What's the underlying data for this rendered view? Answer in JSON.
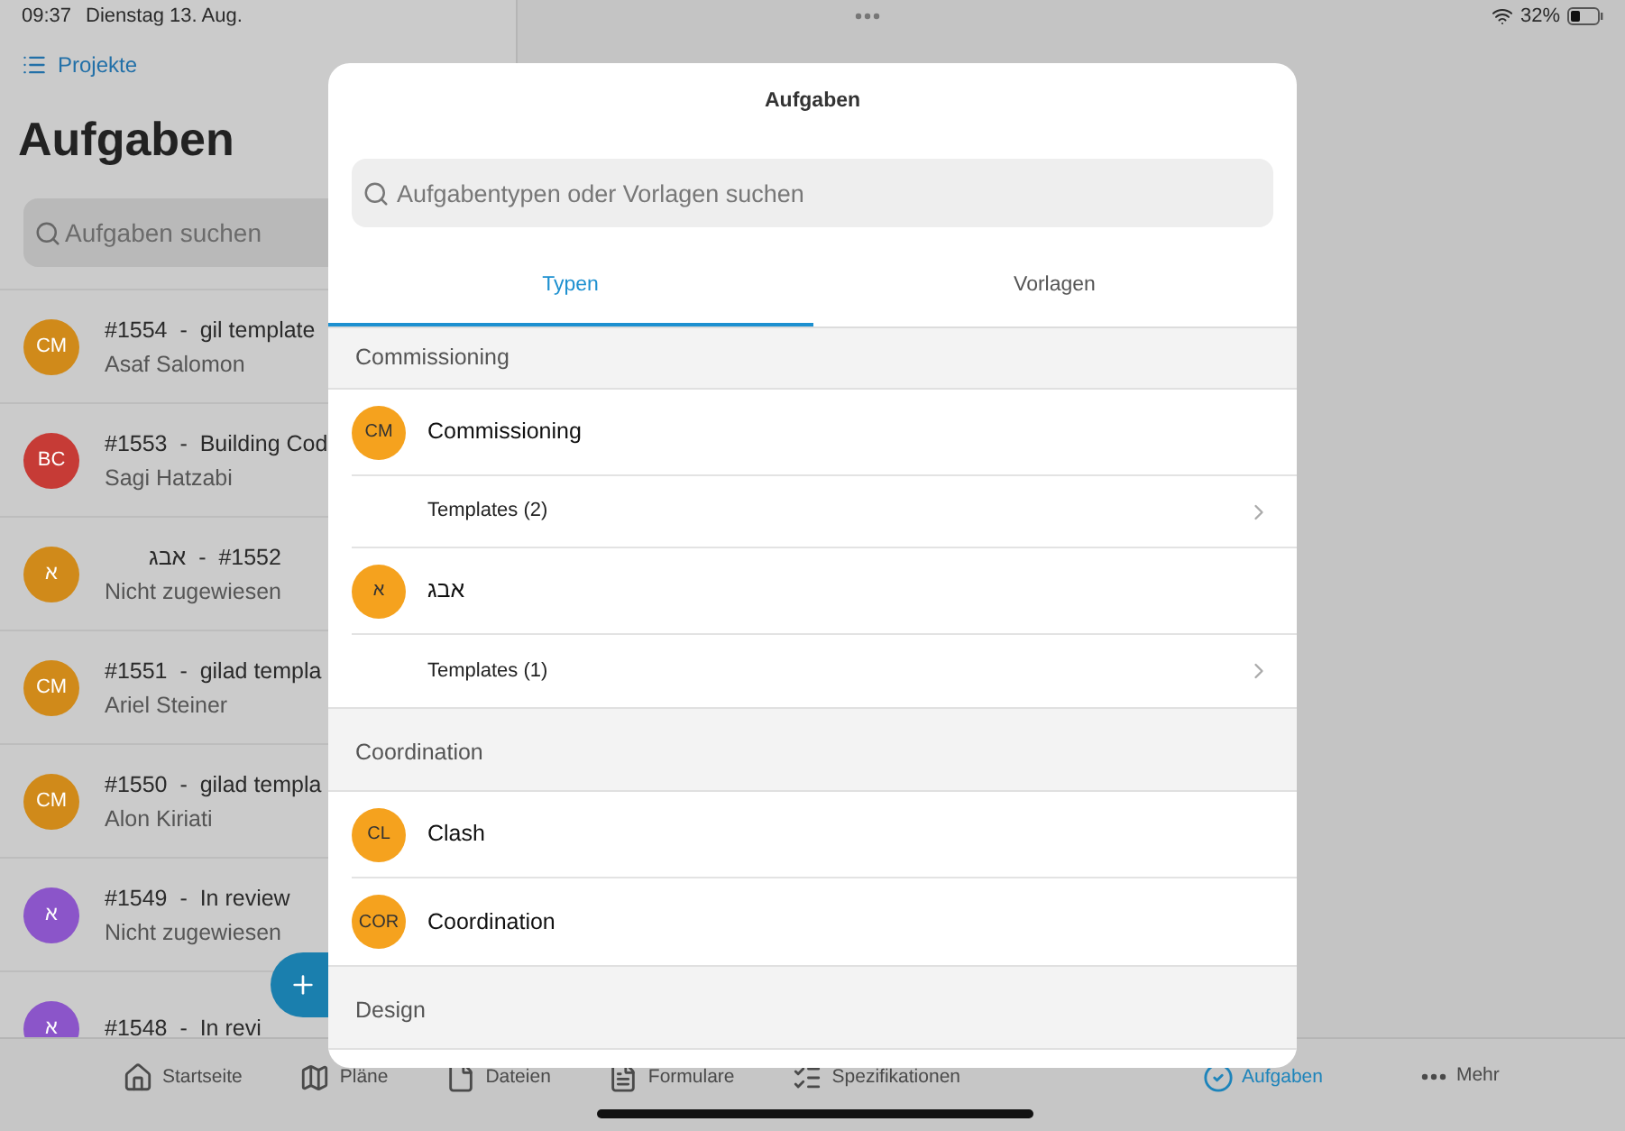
{
  "status_bar": {
    "time": "09:37",
    "date": "Dienstag 13. Aug.",
    "battery": "32%"
  },
  "sidebar": {
    "back_link": "Projekte",
    "title": "Aufgaben",
    "search": {
      "placeholder": "Aufgaben suchen"
    },
    "tasks": [
      {
        "initials": "CM",
        "color": "#d08a1a",
        "title": "#1554  -  gil template",
        "assignee": "Asaf Salomon"
      },
      {
        "initials": "BC",
        "color": "#c63b36",
        "title": "#1553  -  Building Cod",
        "assignee": "Sagi Hatzabi"
      },
      {
        "initials": "א",
        "color": "#d08a1a",
        "title": "#1552  -  אבג",
        "assignee": "Nicht zugewiesen"
      },
      {
        "initials": "CM",
        "color": "#d08a1a",
        "title": "#1551  -  gilad templa",
        "assignee": "Ariel Steiner"
      },
      {
        "initials": "CM",
        "color": "#d08a1a",
        "title": "#1550  -  gilad templa",
        "assignee": "Alon Kiriati"
      },
      {
        "initials": "א",
        "color": "#8b55c9",
        "title": "#1549  -  In review",
        "assignee": "Nicht zugewiesen"
      },
      {
        "initials": "א",
        "color": "#8b55c9",
        "title": "#1548  -  In revi"
      }
    ]
  },
  "dialog": {
    "title": "Aufgaben",
    "search": {
      "placeholder": "Aufgabentypen oder Vorlagen suchen"
    },
    "tabs": [
      {
        "label": "Typen",
        "selected": true
      },
      {
        "label": "Vorlagen",
        "selected": false
      }
    ],
    "sections": [
      {
        "title": "Commissioning",
        "rows": [
          {
            "kind": "type",
            "initials": "CM",
            "label": "Commissioning"
          },
          {
            "kind": "templates",
            "label": "Templates (2)"
          },
          {
            "kind": "type",
            "initials": "א",
            "label": "אבג"
          },
          {
            "kind": "templates",
            "label": "Templates (1)"
          }
        ]
      },
      {
        "title": "Coordination",
        "rows": [
          {
            "kind": "type",
            "initials": "CL",
            "label": "Clash"
          },
          {
            "kind": "type",
            "initials": "COR",
            "label": "Coordination"
          }
        ]
      },
      {
        "title": "Design"
      }
    ]
  },
  "tab_bar": [
    {
      "label": "Startseite",
      "selected": false
    },
    {
      "label": "Pläne",
      "selected": false
    },
    {
      "label": "Dateien",
      "selected": false
    },
    {
      "label": "Formulare",
      "selected": false
    },
    {
      "label": "Spezifikationen",
      "selected": false
    },
    {
      "label": "Aufgaben",
      "selected": true
    },
    {
      "label": "Mehr",
      "selected": false
    }
  ]
}
